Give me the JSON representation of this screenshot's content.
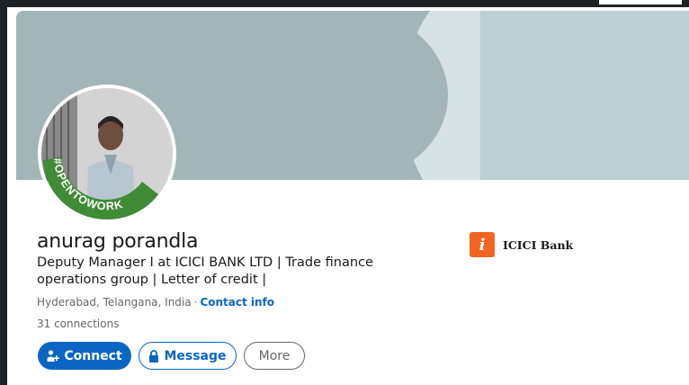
{
  "profile": {
    "name": "anurag porandla",
    "headline": "Deputy Manager I at ICICI BANK LTD | Trade finance operations group | Letter of credit |",
    "location": "Hyderabad, Telangana, India",
    "separator": "·",
    "contact_info": "Contact info",
    "connections": "31 connections",
    "open_to_work_badge": "#OPENTOWORK"
  },
  "company": {
    "name": "ICICI Bank",
    "logo_letter": "i",
    "logo_color": "#f26522"
  },
  "actions": {
    "connect_label": "Connect",
    "message_label": "Message",
    "more_label": "More"
  },
  "colors": {
    "brand_blue": "#0a66c2",
    "open_to_work_green": "#3f8b36",
    "banner": "#a2b5b8"
  },
  "icons": {
    "connect": "add-person-icon",
    "message": "lock-icon"
  }
}
